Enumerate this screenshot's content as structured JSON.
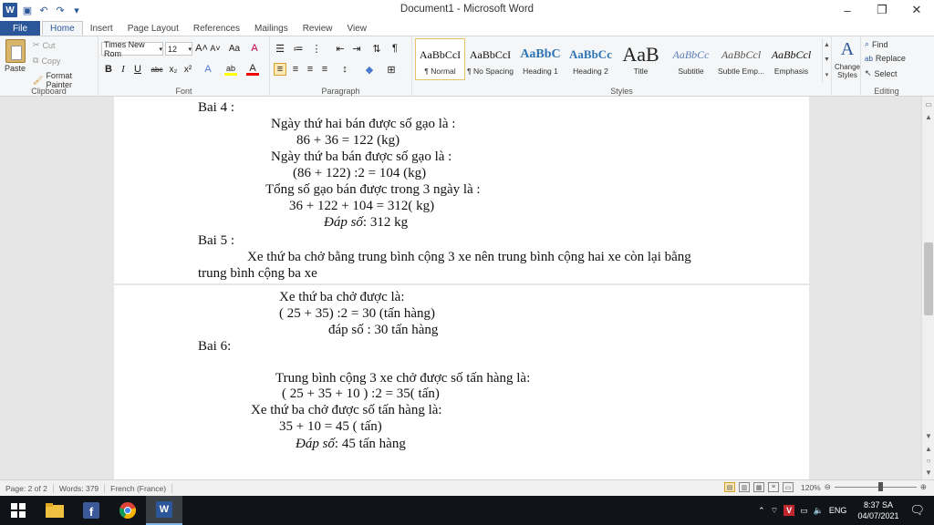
{
  "window": {
    "title": "Document1 - Microsoft Word",
    "controls": [
      "–",
      "❐",
      "✕"
    ]
  },
  "qat": {
    "word": "W",
    "save": "💾",
    "undo": "↶",
    "redo": "↷",
    "more": "▾"
  },
  "tabs": [
    "File",
    "Home",
    "Insert",
    "Page Layout",
    "References",
    "Mailings",
    "Review",
    "View"
  ],
  "active_tab": "Home",
  "ribbon": {
    "clipboard": {
      "label": "Clipboard",
      "paste": "Paste",
      "cut": "Cut",
      "copy": "Copy",
      "format_painter": "Format Painter"
    },
    "font": {
      "label": "Font",
      "name": "Times New Rom",
      "size": "12",
      "grow": "A˄",
      "shrink": "A˅",
      "case": "Aa",
      "clear": "A",
      "bold": "B",
      "italic": "I",
      "underline": "U",
      "strike": "abc",
      "sub": "x₂",
      "sup": "x²",
      "effects": "A",
      "highlight": "ab",
      "color": "A"
    },
    "paragraph": {
      "label": "Paragraph"
    },
    "styles": {
      "label": "Styles",
      "items": [
        {
          "preview": "AaBbCcI",
          "name": "¶ Normal",
          "size": "12px",
          "color": "#111"
        },
        {
          "preview": "AaBbCcI",
          "name": "¶ No Spacing",
          "size": "12px",
          "color": "#111"
        },
        {
          "preview": "AaBbC",
          "name": "Heading 1",
          "size": "14px",
          "color": "#2e74b5"
        },
        {
          "preview": "AaBbCc",
          "name": "Heading 2",
          "size": "13px",
          "color": "#2e74b5"
        },
        {
          "preview": "AaB",
          "name": "Title",
          "size": "22px",
          "color": "#222"
        },
        {
          "preview": "AaBbCc",
          "name": "Subtitle",
          "size": "12px",
          "color": "#5a7db8"
        },
        {
          "preview": "AaBbCcl",
          "name": "Subtle Emp...",
          "size": "12px",
          "color": "#555"
        },
        {
          "preview": "AaBbCcl",
          "name": "Emphasis",
          "size": "12px",
          "color": "#111"
        }
      ],
      "change_styles": "Change Styles"
    },
    "editing": {
      "label": "Editing",
      "find": "Find",
      "replace": "Replace",
      "select": "Select"
    }
  },
  "document": {
    "page1_lines": [
      {
        "text": "Bai 4 :",
        "italic": false
      },
      {
        "text": "Ngày thứ hai bán được số gạo là :",
        "italic": false
      },
      {
        "text": "86 + 36 = 122 (kg)",
        "italic": false
      },
      {
        "text": "Ngày thứ ba bán được số gạo là :",
        "italic": false
      },
      {
        "text": "(86 + 122) :2 = 104 (kg)",
        "italic": false
      },
      {
        "text": "Tổng số gạo bán được trong 3 ngày là :",
        "italic": false
      },
      {
        "text": "36 + 122 + 104 = 312( kg)",
        "italic": false
      },
      {
        "text": "Đáp số",
        "italic": true,
        "suffix": ": 312 kg"
      },
      {
        "text": "Bai 5 :",
        "italic": false
      },
      {
        "text": "Xe thứ ba chở bằng trung bình cộng 3 xe nên trung bình cộng hai xe còn lại bằng",
        "italic": false
      },
      {
        "text": "trung bình cộng ba xe",
        "italic": false
      }
    ],
    "page2_lines": [
      {
        "text": "Xe thứ ba chở được là:",
        "italic": false
      },
      {
        "text": "( 25 + 35) :2 = 30 (tấn hàng)",
        "italic": false
      },
      {
        "text": "đáp số : 30 tấn hàng",
        "italic": false
      },
      {
        "text": "Bai 6:",
        "italic": false
      },
      {
        "text": "Trung bình cộng 3 xe chở được số tấn hàng là:",
        "italic": false
      },
      {
        "text": "( 25 + 35 + 10 ) :2 = 35( tấn)",
        "italic": false
      },
      {
        "text": "Xe thứ ba chở được số tấn hàng là:",
        "italic": false
      },
      {
        "text": "35 + 10 = 45 ( tấn)",
        "italic": false
      },
      {
        "text": "Đáp số",
        "italic": true,
        "suffix": ": 45 tấn hàng"
      }
    ]
  },
  "status": {
    "page": "Page: 2 of 2",
    "words": "Words: 379",
    "language": "French (France)",
    "zoom": "120%"
  },
  "taskbar": {
    "apps": [
      "start-icon",
      "file-explorer-icon",
      "facebook-icon",
      "chrome-icon",
      "word-icon"
    ],
    "lang": "ENG",
    "time": "8:37 SA",
    "date": "04/07/2021"
  }
}
